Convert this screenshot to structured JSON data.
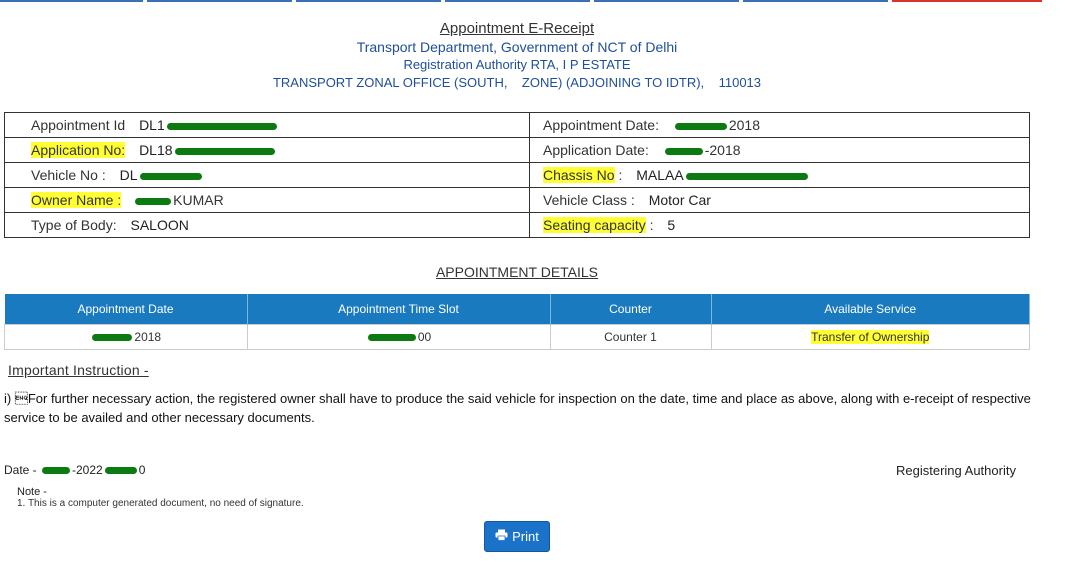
{
  "colors": {
    "accent": "#1a7abf",
    "highlight": "#ffff33",
    "redaction": "#0b7a10"
  },
  "header": {
    "title": "Appointment E-Receipt",
    "department": "Transport Department, Government of NCT of Delhi",
    "authority": "Registration Authority RTA, I P ESTATE",
    "office": "TRANSPORT ZONAL OFFICE (SOUTH,    ZONE) (ADJOINING TO IDTR),    110013"
  },
  "details": {
    "appointment_id_label": "Appointment Id",
    "appointment_id_value": "DL1",
    "appointment_date_label": "Appointment Date:",
    "appointment_date_value": "2018",
    "application_no_label": "Application No:",
    "application_no_value": "DL18",
    "application_date_label": "Application Date:",
    "application_date_value": "-2018",
    "vehicle_no_label": "Vehicle No :",
    "vehicle_no_value": "DL",
    "chassis_no_label": "Chassis No",
    "chassis_no_suffix": " :",
    "chassis_no_value": "MALAA",
    "owner_name_label": "Owner Name :",
    "owner_name_value": "KUMAR",
    "vehicle_class_label": "Vehicle Class :",
    "vehicle_class_value": "Motor Car",
    "body_type_label": "Type of Body:",
    "body_type_value": "SALOON",
    "seating_capacity_label": "Seating capacity",
    "seating_capacity_suffix": " :",
    "seating_capacity_value": "5"
  },
  "appointment_section": {
    "title": "APPOINTMENT DETAILS",
    "columns": [
      "Appointment Date",
      "Appointment Time Slot",
      "Counter",
      "Available Service"
    ],
    "row": {
      "date": "2018",
      "time": "00",
      "counter": "Counter 1",
      "service": "Transfer of Ownership"
    }
  },
  "instructions": {
    "title": "Important Instruction -",
    "text": "i) \u0005For further necessary action, the registered owner shall have to produce the said vehicle for inspection on the date, time and place as above, along with e-receipt of respective service to be availed and other necessary documents."
  },
  "footer": {
    "date_prefix": "Date - ",
    "date_mid": "-2022",
    "date_end": "0",
    "registering_authority": "Registering Authority",
    "note_title": "Note -",
    "note_text": "1. This is a computer generated document, no need of signature.",
    "print_label": "Print"
  },
  "icons": {
    "print": "printer-icon"
  }
}
